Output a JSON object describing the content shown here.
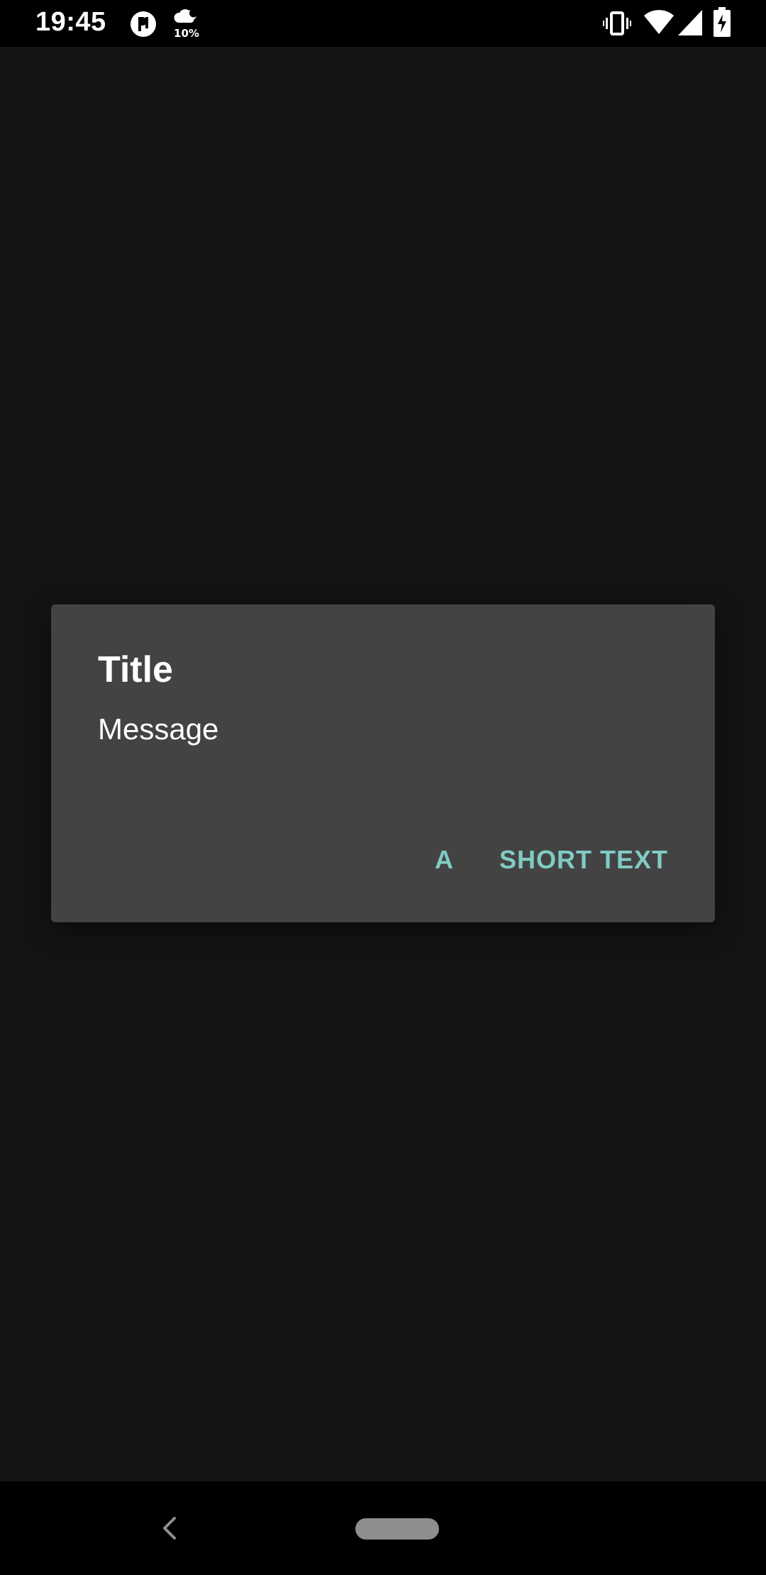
{
  "status_bar": {
    "time": "19:45",
    "weather_percent": "10%",
    "icons": [
      "app-notification-icon",
      "weather-icon",
      "vibrate-icon",
      "wifi-icon",
      "cell-signal-icon",
      "battery-charging-icon"
    ]
  },
  "dialog": {
    "title": "Title",
    "message": "Message",
    "buttons": {
      "secondary_label": "A",
      "primary_label": "SHORT TEXT"
    }
  },
  "nav_bar": {
    "icons": [
      "back-icon",
      "home-pill"
    ]
  },
  "colors": {
    "background": "#141414",
    "dialog_surface": "#434343",
    "accent": "#80cbc4",
    "bars": "#000000"
  }
}
